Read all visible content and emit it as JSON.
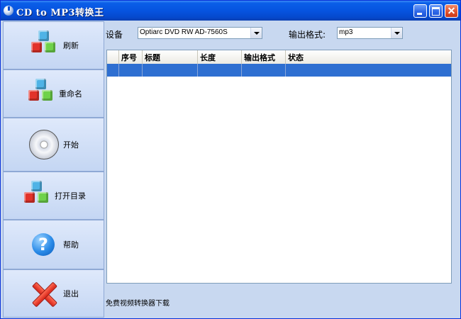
{
  "window": {
    "title": "CD to MP3转换王"
  },
  "sidebar": {
    "items": [
      {
        "label": "刷新",
        "icon": "cubes-icon"
      },
      {
        "label": "重命名",
        "icon": "cubes-icon"
      },
      {
        "label": "开始",
        "icon": "cd-disc-icon"
      },
      {
        "label": "打开目录",
        "icon": "cubes-icon"
      },
      {
        "label": "帮助",
        "icon": "help-icon"
      },
      {
        "label": "退出",
        "icon": "red-x-icon"
      }
    ]
  },
  "main": {
    "device_label": "设备",
    "device_value": "Optiarc DVD RW AD-7560S",
    "format_label": "输出格式:",
    "format_value": "mp3",
    "table": {
      "columns": [
        "",
        "序号",
        "标题",
        "长度",
        "输出格式",
        "状态"
      ],
      "rows": [
        [
          "",
          "",
          "",
          "",
          "",
          ""
        ]
      ],
      "selected_row": 0
    },
    "footer_text": "免费视频转换器下载"
  },
  "colors": {
    "titlebar": "#0654e0",
    "selection": "#2e6fd1",
    "panel_bg": "#c8d8f0"
  }
}
